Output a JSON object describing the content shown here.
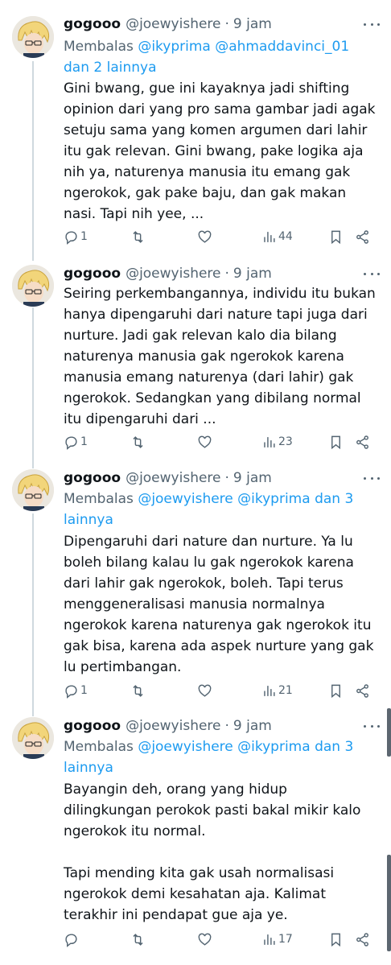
{
  "tweets": [
    {
      "name": "gogooo",
      "handle": "@joewyishere",
      "dot": "·",
      "time": "9 jam",
      "reply_prefix": "Membalas",
      "reply_mentions": "@ikyprima @ahmaddavinci_01",
      "reply_suffix": "dan 2 lainnya",
      "text": "Gini bwang, gue ini kayaknya jadi shifting\nopinion dari yang pro sama gambar jadi agak\nsetuju sama yang komen argumen dari lahir\nitu gak relevan. Gini bwang, pake logika aja\nnih ya, naturenya manusia itu emang gak\nngerokok, gak pake baju, dan gak makan\nnasi. Tapi nih yee, ...",
      "replies": "1",
      "retweets": "",
      "likes": "",
      "views": "44"
    },
    {
      "name": "gogooo",
      "handle": "@joewyishere",
      "dot": "·",
      "time": "9 jam",
      "text": "Seiring perkembangannya, individu itu bukan\nhanya dipengaruhi dari nature tapi juga dari\nnurture. Jadi gak relevan kalo dia bilang\nnaturenya manusia gak ngerokok karena\nmanusia emang naturenya (dari lahir) gak\nngerokok. Sedangkan yang dibilang normal\nitu dipengaruhi dari ...",
      "replies": "1",
      "retweets": "",
      "likes": "",
      "views": "23"
    },
    {
      "name": "gogooo",
      "handle": "@joewyishere",
      "dot": "·",
      "time": "9 jam",
      "reply_prefix": "Membalas",
      "reply_mentions": "@joewyishere @ikyprima",
      "reply_suffix": "dan 3 lainnya",
      "text": "Dipengaruhi dari nature dan nurture. Ya lu\nboleh bilang kalau lu gak ngerokok karena\ndari lahir gak ngerokok, boleh. Tapi terus\nmenggeneralisasi manusia normalnya\nngerokok karena naturenya gak ngerokok itu\ngak bisa, karena ada aspek nurture yang gak\nlu pertimbangan.",
      "replies": "1",
      "retweets": "",
      "likes": "",
      "views": "21"
    },
    {
      "name": "gogooo",
      "handle": "@joewyishere",
      "dot": "·",
      "time": "9 jam",
      "reply_prefix": "Membalas",
      "reply_mentions": "@joewyishere @ikyprima",
      "reply_suffix": "dan 3 lainnya",
      "text": "Bayangin deh, orang yang hidup\ndilingkungan perokok pasti bakal mikir kalo\nngerokok itu normal.\n\nTapi mending kita gak usah normalisasi\nngerokok demi kesahatan aja. Kalimat\nterakhir ini pendapat gue aja ye.",
      "replies": "",
      "retweets": "",
      "likes": "",
      "views": "17"
    }
  ],
  "icons": {
    "more": "more-icon",
    "reply": "reply-icon",
    "retweet": "retweet-icon",
    "like": "like-icon",
    "views": "views-icon",
    "bookmark": "bookmark-icon",
    "share": "share-icon"
  },
  "colors": {
    "mention": "#1d9bf0",
    "secondary_text": "#536471",
    "thread_line": "#cfd9de"
  }
}
